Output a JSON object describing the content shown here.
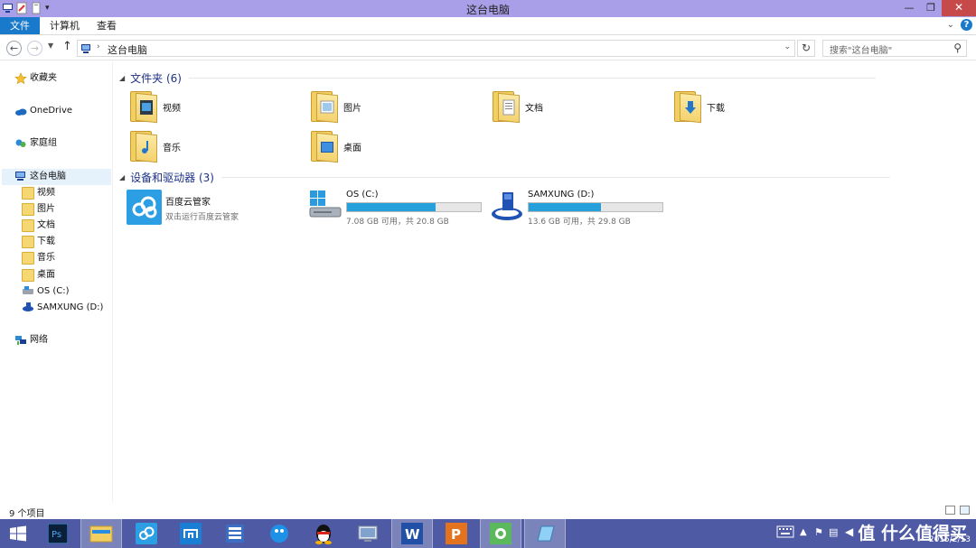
{
  "window": {
    "title": "这台电脑",
    "buttons": [
      "minimize",
      "restore",
      "close"
    ],
    "close_glyph": "✕",
    "min_glyph": "—",
    "max_glyph": "❐"
  },
  "ribbon": {
    "tabs": [
      "文件",
      "计算机",
      "查看"
    ],
    "help": "?"
  },
  "address": {
    "path": "这台电脑",
    "search_placeholder": "搜索\"这台电脑\""
  },
  "nav": {
    "favorites": "收藏夹",
    "onedrive": "OneDrive",
    "homegroup": "家庭组",
    "this_pc": "这台电脑",
    "children": [
      "视频",
      "图片",
      "文档",
      "下载",
      "音乐",
      "桌面",
      "OS (C:)",
      "SAMXUNG (D:)"
    ],
    "network": "网络"
  },
  "folders_section": {
    "heading": "文件夹 (6)",
    "items": [
      "视频",
      "图片",
      "文档",
      "下载",
      "音乐",
      "桌面"
    ]
  },
  "devices_section": {
    "heading": "设备和驱动器 (3)",
    "app": {
      "name": "百度云管家",
      "subtitle": "双击运行百度云管家"
    },
    "drives": [
      {
        "name": "OS (C:)",
        "info": "7.08 GB 可用，共 20.8 GB",
        "used_fraction": 0.66
      },
      {
        "name": "SAMXUNG (D:)",
        "info": "13.6 GB 可用，共 29.8 GB",
        "used_fraction": 0.54
      }
    ]
  },
  "status": {
    "text": "9 个项目"
  },
  "taskbar": {
    "apps": [
      "start",
      "photoshop",
      "file-explorer",
      "baidu-cloud",
      "maxthon",
      "server-manager",
      "ie",
      "qq",
      "network-tool",
      "wps-writer",
      "wps-presentation",
      "screenshot-tool",
      "notepad"
    ],
    "date": "2015/2/13",
    "watermark": "值 什么值得买"
  },
  "colors": {
    "titlebar": "#a99ee8",
    "file_tab": "#1979ca",
    "taskbar": "#4e5aa3",
    "drive_fill": "#26a0da",
    "section_heading": "#1e3287"
  }
}
